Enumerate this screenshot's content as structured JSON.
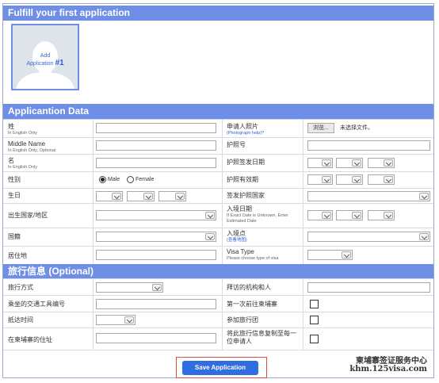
{
  "sections": {
    "fulfill_title": "Fulfill your first application",
    "application_data_title": "Applicantion Data",
    "travel_info_title": "旅行信息 (Optional)"
  },
  "photo_tile": {
    "add": "Add",
    "application": "Application",
    "number": "#1"
  },
  "app_data": {
    "surname": {
      "label": "姓",
      "sub": "In English Only"
    },
    "middle_name": {
      "label": "Middle Name",
      "sub": "In English Only, Optional"
    },
    "given_name": {
      "label": "名",
      "sub": "In English Only"
    },
    "gender": {
      "label": "性别",
      "male": "Male",
      "female": "Female"
    },
    "birthday": {
      "label": "生日"
    },
    "birth_place": {
      "label": "出生国家/地区"
    },
    "nationality": {
      "label": "国籍"
    },
    "residence": {
      "label": "居住地"
    },
    "photo": {
      "label": "申请人照片",
      "sub": "(Photograph help)?",
      "browse": "浏览...",
      "no_file": "未选择文件。"
    },
    "passport_no": {
      "label": "护照号"
    },
    "passport_issue": {
      "label": "护照签发日期"
    },
    "passport_expiry": {
      "label": "护照有效期"
    },
    "issuing_country": {
      "label": "签发护照国家"
    },
    "entry_date": {
      "label": "入境日期",
      "sub": "If Exact Date is Unknown, Enter Estimated Date"
    },
    "entry_point": {
      "label": "入境点",
      "sub": "(查看地图)"
    },
    "visa_type": {
      "label": "Visa Type",
      "sub": "Please choose type of visa"
    }
  },
  "travel": {
    "travel_mode": {
      "label": "旅行方式"
    },
    "transport_no": {
      "label": "乘坐的交通工具编号"
    },
    "arrival_time": {
      "label": "抵达时间"
    },
    "cambodia_address": {
      "label": "在柬埔寨的住址"
    },
    "visit_org": {
      "label": "拜访的机构和人"
    },
    "first_time": {
      "label": "第一次前往柬埔寨"
    },
    "tour_group": {
      "label": "参加旅行团"
    },
    "copy_info": {
      "label": "将此旅行信息复制至每一位申请人"
    }
  },
  "save_button": "Save Application",
  "watermark": {
    "line1": "柬埔寨签证服务中心",
    "line2": "khm.125visa.com"
  }
}
